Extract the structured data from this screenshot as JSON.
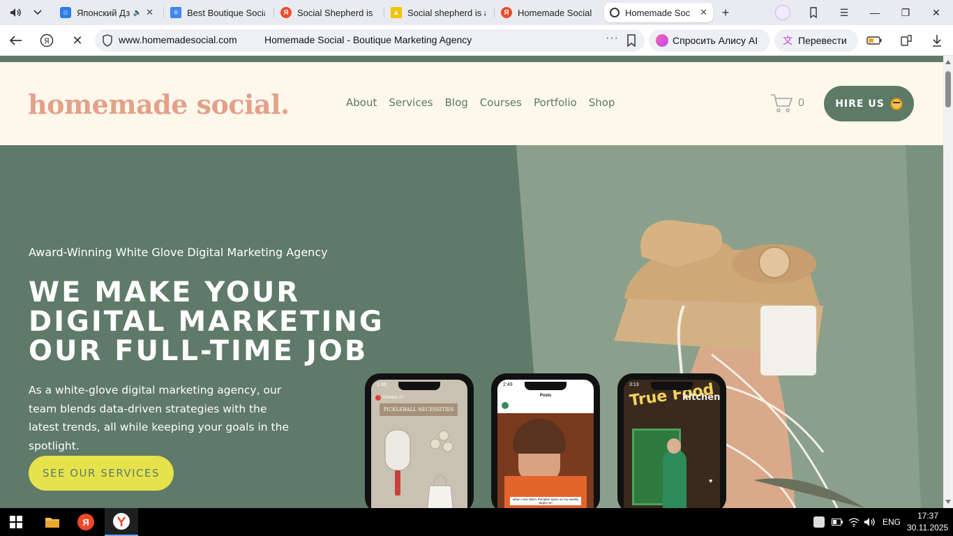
{
  "browser": {
    "tabs": [
      {
        "title": "Японский Дз",
        "icon": "zen-icon",
        "color": "#2b7de9",
        "audio": true
      },
      {
        "title": "Best Boutique Social",
        "icon": "docs-icon",
        "color": "#4285f4"
      },
      {
        "title": "Social Shepherd is a",
        "icon": "yandex-icon",
        "color": "#f0492a"
      },
      {
        "title": "Social shepherd is a",
        "icon": "image-icon",
        "color": "#f5c400"
      },
      {
        "title": "Homemade Social",
        "icon": "yandex-icon",
        "color": "#f0492a"
      },
      {
        "title": "Homemade Soc",
        "icon": "loading-icon",
        "color": "#333333",
        "active": true
      }
    ],
    "address": {
      "domain": "www.homemadesocial.com",
      "page_title": "Homemade Social - Boutique Marketing Agency"
    },
    "alice_label": "Спросить Алису AI",
    "translate_label": "Перевести"
  },
  "site": {
    "logo_text": "homemade social",
    "logo_dot": ".",
    "nav": [
      "About",
      "Services",
      "Blog",
      "Courses",
      "Portfolio",
      "Shop"
    ],
    "cart_count": "0",
    "hire_label": "HIRE US",
    "colors": {
      "brand_green": "#5c7a66",
      "logo_pink": "#e2a188",
      "cream": "#fdf7ec",
      "cta_yellow": "#e6e24c"
    }
  },
  "hero": {
    "kicker": "Award-Winning White Glove Digital Marketing Agency",
    "title_lines": [
      "WE MAKE YOUR",
      "DIGITAL MARKETING",
      "OUR FULL-TIME JOB"
    ],
    "body": "As a white-glove digital marketing agency, our team blends data-driven strategies with the latest trends, all while keeping your goals in the spotlight.",
    "cta": "SEE OUR SERVICES"
  },
  "phones": [
    {
      "time": "1:36",
      "header": "October 27",
      "title": "PICKLEBALL NECESSITIES"
    },
    {
      "time": "2:49",
      "header": "Posts",
      "caption": "when I see Tate's Pumpkin Spice on my weekly target run"
    },
    {
      "time": "3:13",
      "sign": "True Food",
      "sign2": "kitchen"
    }
  ],
  "taskbar": {
    "language": "ENG",
    "time": "17:37",
    "date": "30.11.2025"
  }
}
